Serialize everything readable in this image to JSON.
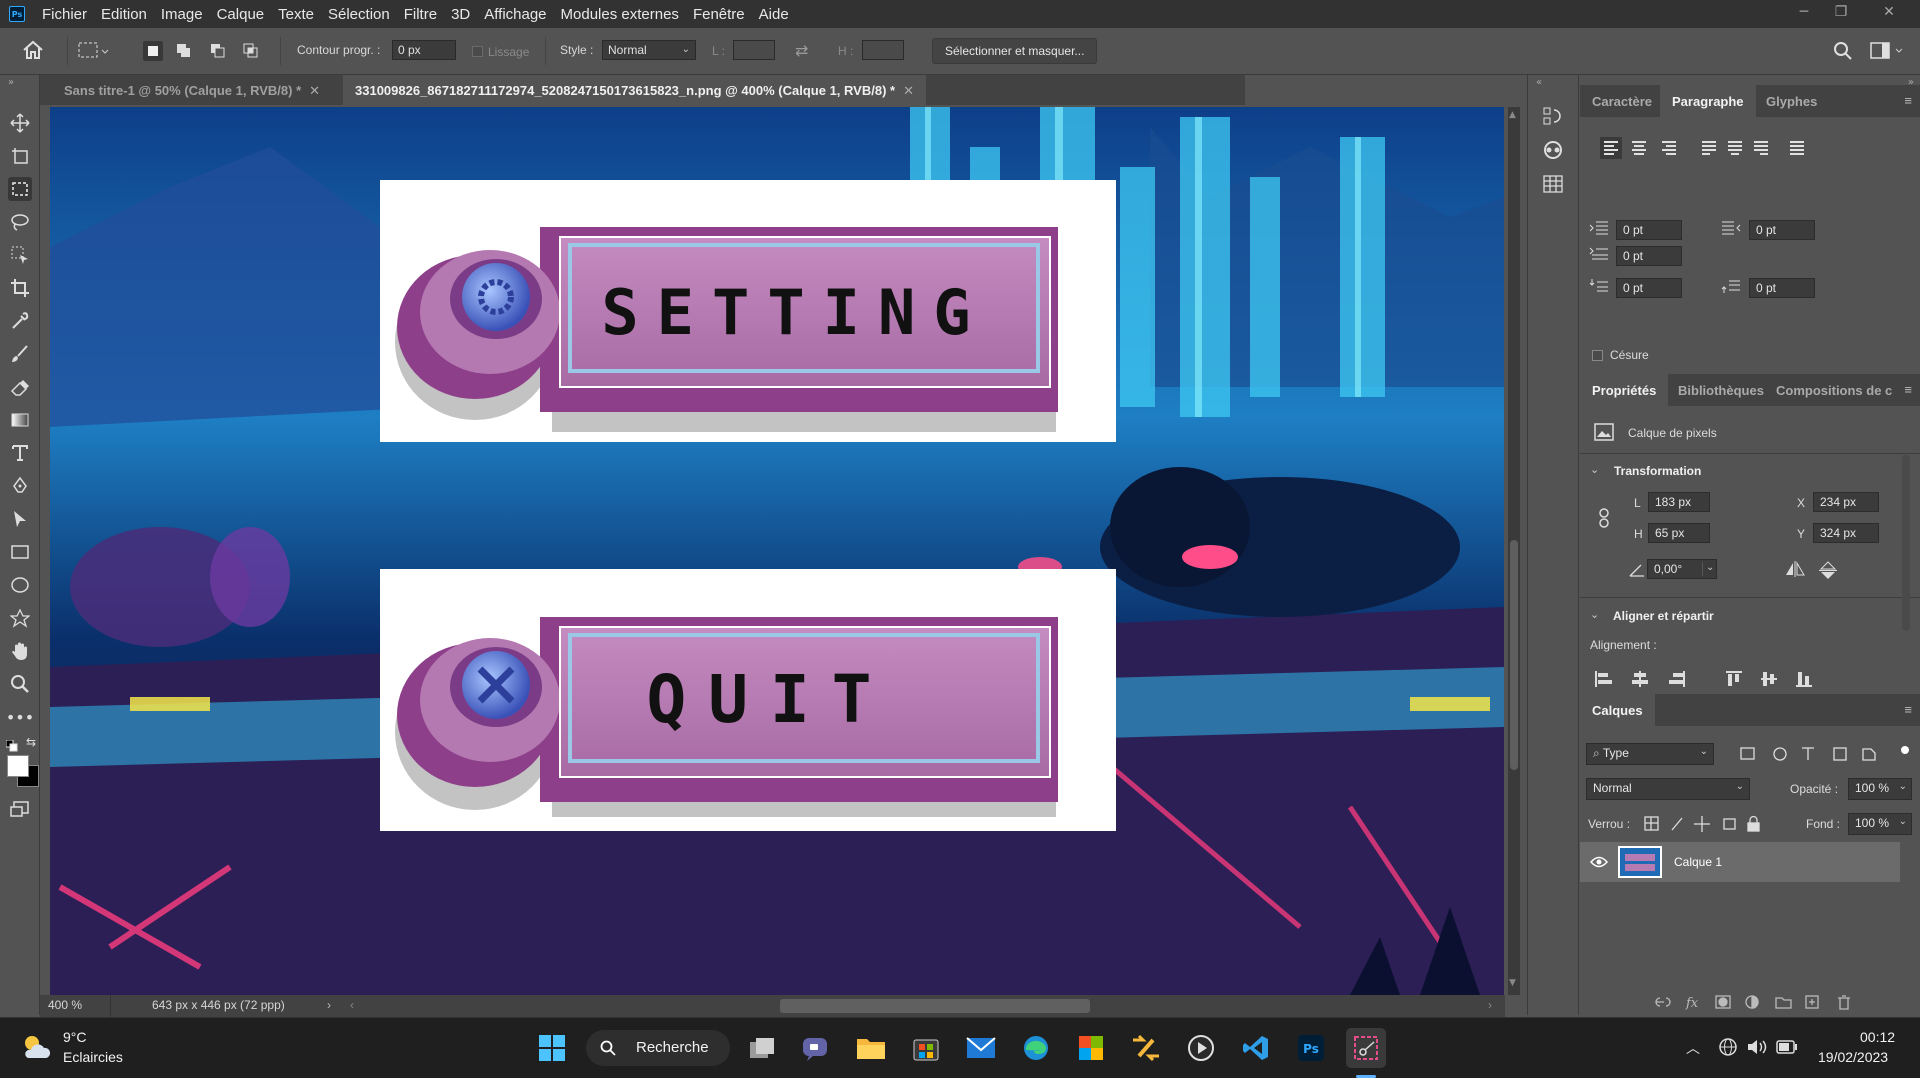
{
  "app": {
    "logo": "Ps"
  },
  "menu": [
    "Fichier",
    "Edition",
    "Image",
    "Calque",
    "Texte",
    "Sélection",
    "Filtre",
    "3D",
    "Affichage",
    "Modules externes",
    "Fenêtre",
    "Aide"
  ],
  "options": {
    "contour_label": "Contour progr. :",
    "contour_value": "0 px",
    "lissage_label": "Lissage",
    "style_label": "Style :",
    "style_value": "Normal",
    "l_label": "L :",
    "h_label": "H :",
    "select_mask_button": "Sélectionner et masquer..."
  },
  "tabs": [
    {
      "label": "Sans titre-1 @ 50% (Calque 1, RVB/8) *"
    },
    {
      "label": "331009826_867182711172974_5208247150173615823_n.png @ 400% (Calque 1, RVB/8) *"
    }
  ],
  "canvas": {
    "button1_text": "SETTING",
    "button2_text": "QUIT"
  },
  "status": {
    "zoom": "400 %",
    "dimensions": "643 px x 446 px (72 ppp)"
  },
  "paragraph_panel": {
    "tabs": [
      "Caractère",
      "Paragraphe",
      "Glyphes"
    ],
    "indent_left": "0 pt",
    "indent_right": "0 pt",
    "indent_first": "0 pt",
    "space_before": "0 pt",
    "space_after": "0 pt",
    "hyphenation": "Césure"
  },
  "properties_panel": {
    "tabs": [
      "Propriétés",
      "Bibliothèques",
      "Compositions de c"
    ],
    "layer_type": "Calque de pixels",
    "transform_title": "Transformation",
    "w_label": "L",
    "w_value": "183 px",
    "h_label": "H",
    "h_value": "65 px",
    "x_label": "X",
    "x_value": "234 px",
    "y_label": "Y",
    "y_value": "324 px",
    "angle_value": "0,00°",
    "align_title": "Aligner et répartir",
    "align_label": "Alignement :"
  },
  "layers_panel": {
    "title": "Calques",
    "filter": "Type",
    "blend_mode": "Normal",
    "opacity_label": "Opacité :",
    "opacity_value": "100 %",
    "lock_label": "Verrou :",
    "fill_label": "Fond :",
    "fill_value": "100 %",
    "layers": [
      {
        "name": "Calque 1"
      }
    ]
  },
  "taskbar": {
    "weather_temp": "9°C",
    "weather_desc": "Eclaircies",
    "search_label": "Recherche",
    "time": "00:12",
    "date": "19/02/2023"
  },
  "colors": {
    "button_purple": "#b77bb3",
    "button_dark": "#8e3f8a",
    "button_border": "#9cc8e8",
    "canvas_sky": "#1e7fc4"
  }
}
